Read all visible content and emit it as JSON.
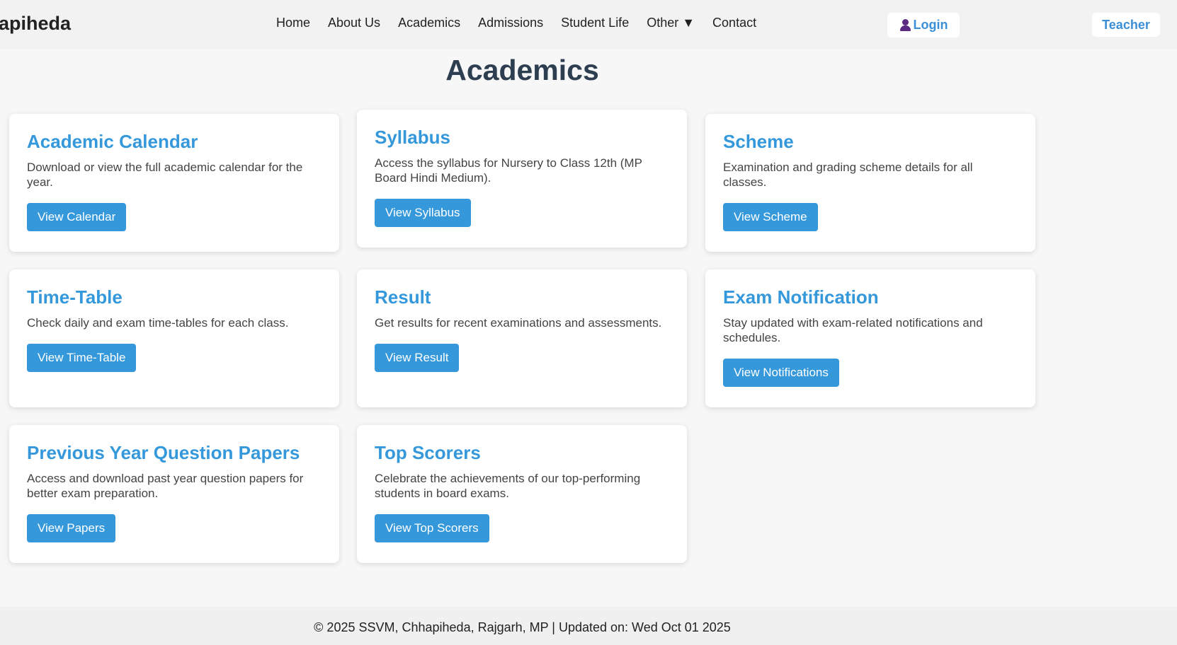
{
  "header": {
    "brand": "apiheda",
    "nav": [
      "Home",
      "About Us",
      "Academics",
      "Admissions",
      "Student Life",
      "Other ▼",
      "Contact"
    ],
    "login_label": "Login",
    "teacher_label": "Teacher"
  },
  "page": {
    "title": "Academics"
  },
  "cards": [
    {
      "title": "Academic Calendar",
      "desc": "Download or view the full academic calendar for the year.",
      "button": "View Calendar"
    },
    {
      "title": "Syllabus",
      "desc": "Access the syllabus for Nursery to Class 12th (MP Board Hindi Medium).",
      "button": "View Syllabus"
    },
    {
      "title": "Scheme",
      "desc": "Examination and grading scheme details for all classes.",
      "button": "View Scheme"
    },
    {
      "title": "Time-Table",
      "desc": "Check daily and exam time-tables for each class.",
      "button": "View Time-Table"
    },
    {
      "title": "Result",
      "desc": "Get results for recent examinations and assessments.",
      "button": "View Result"
    },
    {
      "title": "Exam Notification",
      "desc": "Stay updated with exam-related notifications and schedules.",
      "button": "View Notifications"
    },
    {
      "title": "Previous Year Question Papers",
      "desc": "Access and download past year question papers for better exam preparation.",
      "button": "View Papers"
    },
    {
      "title": "Top Scorers",
      "desc": "Celebrate the achievements of our top-performing students in board exams.",
      "button": "View Top Scorers"
    }
  ],
  "footer": {
    "text": "© 2025 SSVM, Chhapiheda, Rajgarh, MP | Updated on: Wed Oct 01 2025"
  },
  "colors": {
    "accent": "#3498db",
    "title": "#2c3e50",
    "background": "#f7f7f7"
  }
}
